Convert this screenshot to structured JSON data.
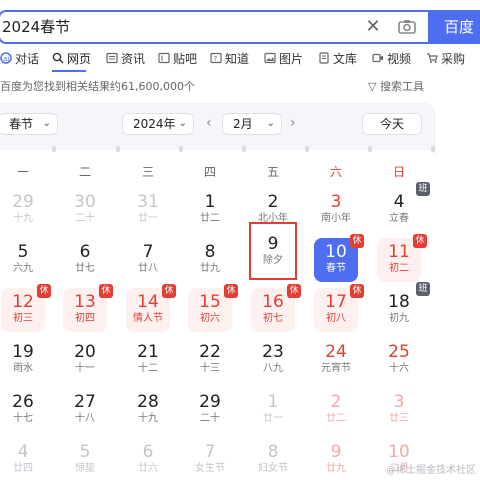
{
  "search": {
    "query": "2024春节",
    "button_label": "百度一下"
  },
  "tabs": [
    {
      "label": "对话",
      "icon": "ai-chat-icon"
    },
    {
      "label": "网页",
      "icon": "search-icon"
    },
    {
      "label": "资讯",
      "icon": "news-icon"
    },
    {
      "label": "贴吧",
      "icon": "tieba-icon"
    },
    {
      "label": "知道",
      "icon": "question-icon"
    },
    {
      "label": "图片",
      "icon": "image-icon"
    },
    {
      "label": "文库",
      "icon": "doc-icon"
    },
    {
      "label": "视频",
      "icon": "video-icon"
    },
    {
      "label": "采购",
      "icon": "cart-icon"
    }
  ],
  "result_info": "百度为您找到相关结果约61,600,000个",
  "search_tools": "搜索工具",
  "calendar": {
    "holiday_select": "春节",
    "year_select": "2024年",
    "month_select": "2月",
    "today_label": "今天",
    "weekdays": [
      "一",
      "二",
      "三",
      "四",
      "五",
      "六",
      "日"
    ],
    "rows": [
      [
        {
          "n": "29",
          "s": "十九",
          "type": "other"
        },
        {
          "n": "30",
          "s": "二十",
          "type": "other"
        },
        {
          "n": "31",
          "s": "廿一",
          "type": "other"
        },
        {
          "n": "1",
          "s": "廿二",
          "type": "normal"
        },
        {
          "n": "2",
          "s": "北小年",
          "type": "normal"
        },
        {
          "n": "3",
          "s": "南小年",
          "type": "red"
        },
        {
          "n": "4",
          "s": "立春",
          "type": "normal",
          "badge": "班",
          "badge_type": "work"
        }
      ],
      [
        {
          "n": "5",
          "s": "六九",
          "type": "normal"
        },
        {
          "n": "6",
          "s": "廿七",
          "type": "normal"
        },
        {
          "n": "7",
          "s": "廿八",
          "type": "normal"
        },
        {
          "n": "8",
          "s": "廿九",
          "type": "normal"
        },
        {
          "n": "9",
          "s": "除夕",
          "type": "selected"
        },
        {
          "n": "10",
          "s": "春节",
          "type": "today",
          "badge": "休"
        },
        {
          "n": "11",
          "s": "初二",
          "type": "holiday",
          "badge": "休"
        }
      ],
      [
        {
          "n": "12",
          "s": "初三",
          "type": "holiday",
          "badge": "休"
        },
        {
          "n": "13",
          "s": "初四",
          "type": "holiday",
          "badge": "休"
        },
        {
          "n": "14",
          "s": "情人节",
          "type": "holiday",
          "badge": "休"
        },
        {
          "n": "15",
          "s": "初六",
          "type": "holiday",
          "badge": "休"
        },
        {
          "n": "16",
          "s": "初七",
          "type": "holiday",
          "badge": "休"
        },
        {
          "n": "17",
          "s": "初八",
          "type": "holiday",
          "badge": "休"
        },
        {
          "n": "18",
          "s": "初九",
          "type": "normal",
          "badge": "班",
          "badge_type": "work"
        }
      ],
      [
        {
          "n": "19",
          "s": "雨水",
          "type": "normal"
        },
        {
          "n": "20",
          "s": "十一",
          "type": "normal"
        },
        {
          "n": "21",
          "s": "十二",
          "type": "normal"
        },
        {
          "n": "22",
          "s": "十三",
          "type": "normal"
        },
        {
          "n": "23",
          "s": "八九",
          "type": "normal"
        },
        {
          "n": "24",
          "s": "元宵节",
          "type": "red"
        },
        {
          "n": "25",
          "s": "十六",
          "type": "red"
        }
      ],
      [
        {
          "n": "26",
          "s": "十七",
          "type": "normal"
        },
        {
          "n": "27",
          "s": "十八",
          "type": "normal"
        },
        {
          "n": "28",
          "s": "十九",
          "type": "normal"
        },
        {
          "n": "29",
          "s": "二十",
          "type": "normal"
        },
        {
          "n": "1",
          "s": "廿一",
          "type": "other"
        },
        {
          "n": "2",
          "s": "廿二",
          "type": "other-red"
        },
        {
          "n": "3",
          "s": "廿三",
          "type": "other-red"
        }
      ],
      [
        {
          "n": "4",
          "s": "廿四",
          "type": "other"
        },
        {
          "n": "5",
          "s": "惊蛰",
          "type": "other"
        },
        {
          "n": "6",
          "s": "廿六",
          "type": "other"
        },
        {
          "n": "7",
          "s": "女生节",
          "type": "other"
        },
        {
          "n": "8",
          "s": "妇女节",
          "type": "other"
        },
        {
          "n": "9",
          "s": "廿九",
          "type": "other-red"
        },
        {
          "n": "10",
          "s": "二月",
          "type": "other-red"
        }
      ]
    ]
  },
  "watermark": "@稀土掘金技术社区",
  "colors": {
    "accent": "#4e6ef2",
    "holiday": "#e33e33"
  }
}
